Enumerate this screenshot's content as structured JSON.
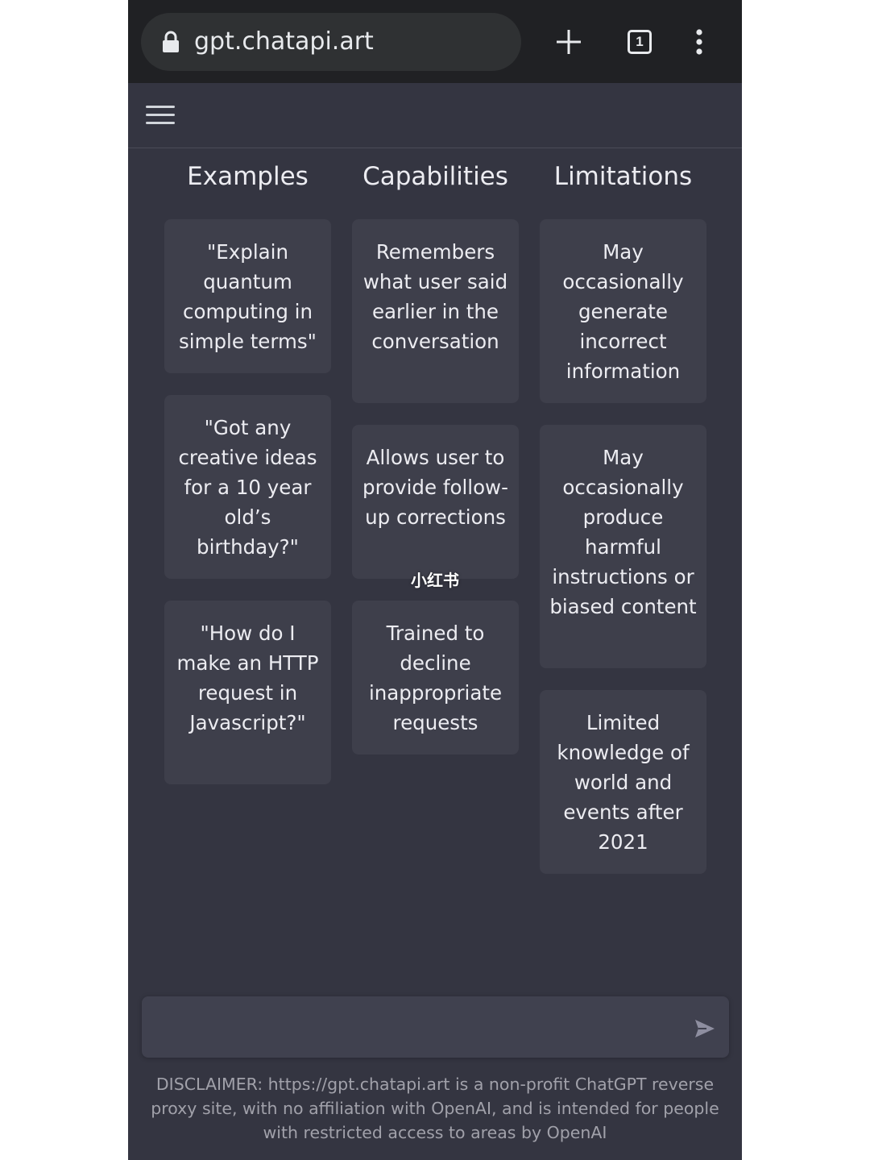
{
  "browser": {
    "url": "gpt.chatapi.art",
    "tab_count": "1",
    "icons": [
      "lock-icon",
      "plus-icon",
      "tabs-icon",
      "more-vert-icon"
    ]
  },
  "appbar": {
    "menu_icon": "hamburger-icon"
  },
  "columns": [
    {
      "title": "Examples",
      "cards": [
        "\"Explain quantum computing in simple terms\"",
        "\"Got any creative ideas for a 10 year old’s birthday?\"",
        "\"How do I make an HTTP request in Javascript?\""
      ]
    },
    {
      "title": "Capabilities",
      "cards": [
        "Remembers what user said earlier in the conversation",
        "Allows user to provide follow-up corrections",
        "Trained to decline inappropriate requests"
      ]
    },
    {
      "title": "Limitations",
      "cards": [
        "May occasionally generate incorrect information",
        "May occasionally produce harmful instructions or biased content",
        "Limited knowledge of world and events after 2021"
      ]
    }
  ],
  "watermark": "小红书",
  "composer": {
    "value": "",
    "send_icon": "send-icon"
  },
  "disclaimer": "DISCLAIMER: https://gpt.chatapi.art is a non-profit ChatGPT reverse proxy site, with no affiliation with OpenAI, and is intended for people with restricted access to areas by OpenAI",
  "colors": {
    "browser_bar": "#202124",
    "background": "#343541",
    "card": "#3e3f4b",
    "input": "#40414f",
    "text": "#ececf1"
  }
}
